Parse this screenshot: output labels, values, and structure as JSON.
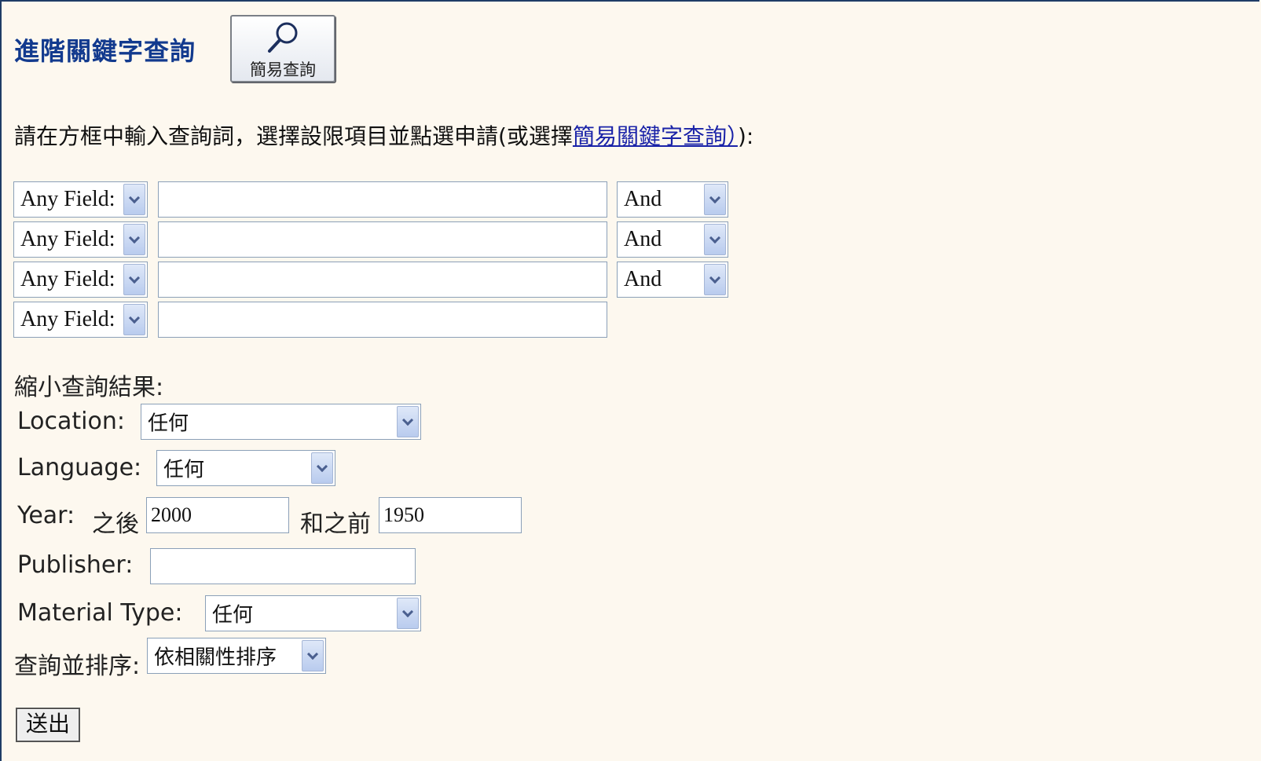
{
  "header": {
    "title": "進階關鍵字查詢",
    "simple_button_label": "簡易查詢"
  },
  "instructions": {
    "text_before": "請在方框中輸入查詢詞，選擇設限項目並點選申請(或選擇",
    "link_text": "簡易關鍵字查詢）",
    "text_after": "):"
  },
  "search_rows": [
    {
      "field": "Any Field:",
      "term": "",
      "operator": "And"
    },
    {
      "field": "Any Field:",
      "term": "",
      "operator": "And"
    },
    {
      "field": "Any Field:",
      "term": "",
      "operator": "And"
    },
    {
      "field": "Any Field:",
      "term": ""
    }
  ],
  "limits": {
    "heading": "縮小查詢結果:",
    "location_label": "Location:",
    "location_value": "任何",
    "language_label": "Language:",
    "language_value": "任何",
    "year_label": "Year:",
    "year_after_label": "之後",
    "year_after_value": "2000",
    "year_before_label": "和之前",
    "year_before_value": "1950",
    "publisher_label": "Publisher:",
    "publisher_value": "",
    "material_label": "Material Type:",
    "material_value": "任何",
    "sort_label": "查詢並排序:",
    "sort_value": "依相關性排序"
  },
  "submit_label": "送出",
  "colors": {
    "background": "#fdf8ef",
    "title": "#123a8e",
    "link": "#1a23a8"
  }
}
